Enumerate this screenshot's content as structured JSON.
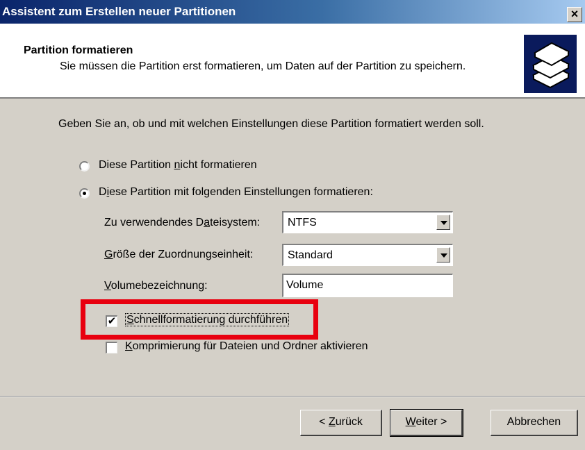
{
  "window": {
    "title": "Assistent zum Erstellen neuer Partitionen",
    "close_glyph": "×"
  },
  "header": {
    "title": "Partition formatieren",
    "subtitle": "Sie müssen die Partition erst formatieren, um Daten auf der Partition zu speichern.",
    "icon": "stacked-disks-icon"
  },
  "intro": "Geben Sie an, ob und mit welchen Einstellungen diese Partition formatiert werden soll.",
  "options": {
    "no_format": {
      "pre": "Diese Partition ",
      "accel": "n",
      "post": "icht formatieren",
      "selected": false
    },
    "format": {
      "pre": "D",
      "accel": "i",
      "post": "ese Partition mit folgenden Einstellungen formatieren:",
      "selected": true
    }
  },
  "settings": {
    "filesystem": {
      "label_pre": "Zu verwendendes D",
      "label_accel": "a",
      "label_post": "teisystem:",
      "value": "NTFS"
    },
    "allocation_unit": {
      "label_pre": "",
      "label_accel": "G",
      "label_post": "röße der Zuordnungseinheit:",
      "value": "Standard"
    },
    "volume_label": {
      "label_pre": "",
      "label_accel": "V",
      "label_post": "olumebezeichnung:",
      "value": "Volume"
    }
  },
  "checkboxes": {
    "quick_format": {
      "accel": "S",
      "post": "chnellformatierung durchführen",
      "checked": true,
      "check_glyph": "✔"
    },
    "compression": {
      "accel": "K",
      "post": "omprimierung für Dateien und Ordner aktivieren",
      "checked": false
    }
  },
  "annotation": {
    "color": "#e8000f"
  },
  "buttons": {
    "back": {
      "pre": "< ",
      "accel": "Z",
      "post": "urück"
    },
    "next": {
      "pre": "",
      "accel": "W",
      "post": "eiter >"
    },
    "cancel": {
      "label": "Abbrechen"
    }
  },
  "colors": {
    "titlebar_start": "#0a246a",
    "titlebar_end": "#a6caf0",
    "face": "#d4d0c8",
    "icon_bg": "#0a1a5c"
  }
}
